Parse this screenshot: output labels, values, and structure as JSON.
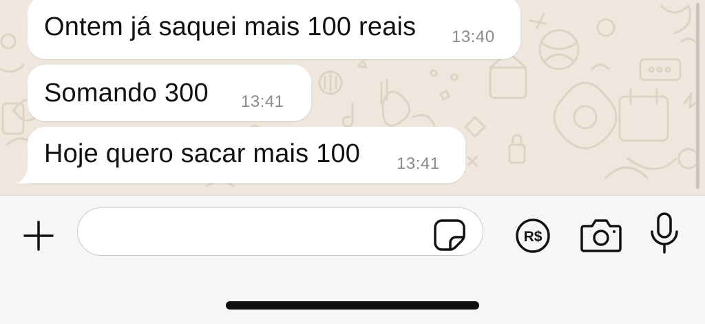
{
  "messages": [
    {
      "text": "Ontem já saquei mais 100 reais",
      "time": "13:40"
    },
    {
      "text": "Somando 300",
      "time": "13:41"
    },
    {
      "text": "Hoje quero sacar mais 100",
      "time": "13:41"
    }
  ],
  "composer": {
    "input_value": "",
    "plus_icon": "plus-icon",
    "sticker_icon": "sticker-icon",
    "payment_icon": "payment-icon",
    "payment_label": "R$",
    "camera_icon": "camera-icon",
    "mic_icon": "microphone-icon"
  },
  "colors": {
    "chat_background": "#efe7dd",
    "bubble": "#ffffff",
    "timestamp": "#8a8a8a",
    "input_bar": "#f6f6f6"
  }
}
